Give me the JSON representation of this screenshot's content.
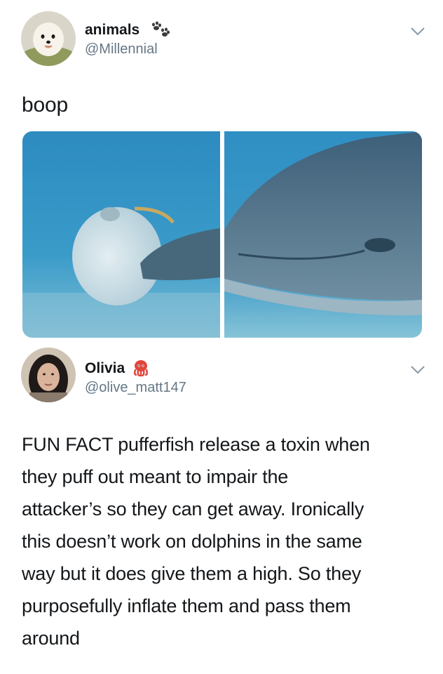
{
  "tweet1": {
    "display_name": "animals",
    "name_icon": "paw-prints-icon",
    "handle": "@Millennial",
    "text": "boop",
    "menu_icon": "chevron-down-icon",
    "avatar_icon": "pomeranian-avatar"
  },
  "media": {
    "left_image": "pufferfish-pushed-by-dolphin-photo",
    "right_image": "dolphin-closeup-photo"
  },
  "tweet2": {
    "display_name": "Olivia",
    "name_icon": "octopus-emoji-icon",
    "handle": "@olive_matt147",
    "menu_icon": "chevron-down-icon",
    "avatar_icon": "user-photo-avatar",
    "text_lines": [
      "FUN FACT pufferfish release a toxin when",
      "they puff out meant to impair the",
      "attacker’s so they can get away. Ironically",
      "this doesn’t work on dolphins in the same",
      "way but it does give them a high. So they",
      "purposefully inflate them and pass them",
      "around"
    ]
  },
  "colors": {
    "text": "#14171a",
    "muted": "#657786",
    "water": "#2f8fc0"
  }
}
